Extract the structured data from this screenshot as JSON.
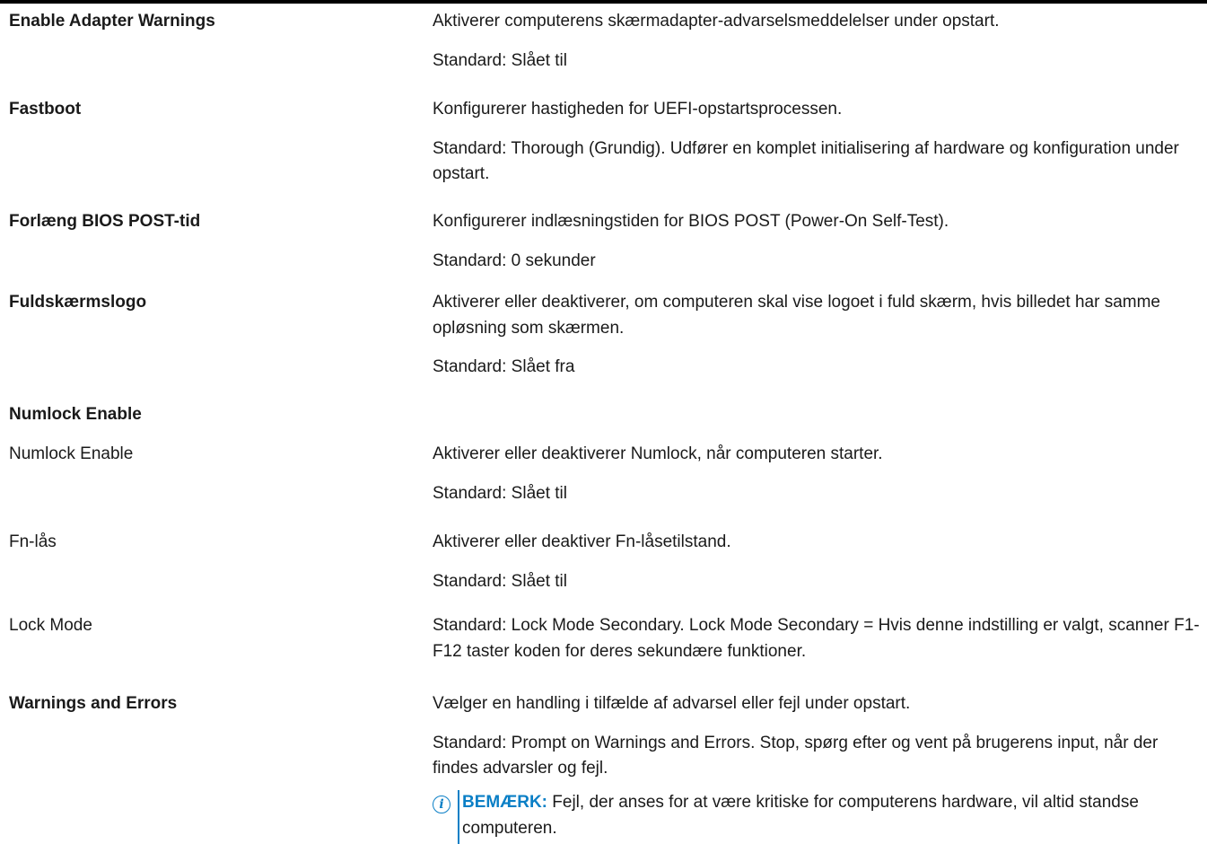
{
  "rows": [
    {
      "label": "Enable Adapter Warnings",
      "desc": [
        "Aktiverer computerens skærmadapter-advarselsmeddelelser under opstart.",
        "Standard: Slået til"
      ]
    },
    {
      "label": "Fastboot",
      "desc": [
        "Konfigurerer hastigheden for UEFI-opstartsprocessen.",
        "Standard: Thorough (Grundig). Udfører en komplet initialisering af hardware og konfiguration under opstart."
      ]
    },
    {
      "label": "Forlæng BIOS POST-tid",
      "desc": [
        "Konfigurerer indlæsningstiden for BIOS POST (Power-On Self-Test).",
        "Standard: 0 sekunder"
      ]
    },
    {
      "label": "Fuldskærmslogo",
      "desc": [
        "Aktiverer eller deaktiverer, om computeren skal vise logoet i fuld skærm, hvis billedet har samme opløsning som skærmen.",
        "Standard: Slået fra"
      ]
    },
    {
      "label": "Numlock Enable"
    },
    {
      "label": "Numlock Enable",
      "desc": [
        "Aktiverer eller deaktiverer Numlock, når computeren starter.",
        "Standard: Slået til"
      ]
    },
    {
      "label": "Fn-lås",
      "desc": [
        "Aktiverer eller deaktiver Fn-låsetilstand.",
        "Standard: Slået til"
      ]
    },
    {
      "label": "Lock Mode",
      "desc": [
        "Standard: Lock Mode Secondary. Lock Mode Secondary = Hvis denne indstilling er valgt, scanner F1-F12 taster koden for deres sekundære funktioner."
      ]
    },
    {
      "label": "Warnings and Errors",
      "desc": [
        "Vælger en handling i tilfælde af advarsel eller fejl under opstart.",
        "Standard: Prompt on Warnings and Errors. Stop, spørg efter og vent på brugerens input, når der findes advarsler og fejl."
      ]
    }
  ],
  "note": {
    "icon": "info-icon",
    "heading": "BEMÆRK:",
    "text": " Fejl, der anses for at være kritiske for computerens hardware, vil altid standse computeren."
  },
  "colors": {
    "note_accent": "#0a7fc6"
  }
}
